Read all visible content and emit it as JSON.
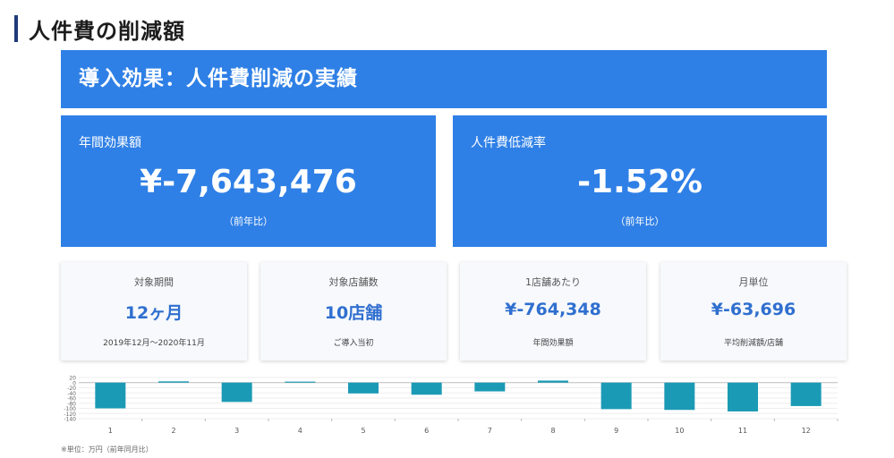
{
  "page_title": "人件費の削減額",
  "banner": {
    "title": "導入効果：人件費削減の実績"
  },
  "kpis": [
    {
      "label": "年間効果額",
      "value": "¥-7,643,476",
      "note": "（前年比）"
    },
    {
      "label": "人件費低減率",
      "value": "-1.52%",
      "note": "（前年比）"
    }
  ],
  "cards": [
    {
      "label": "対象期間",
      "value": "12ヶ月",
      "note": "2019年12月〜2020年11月"
    },
    {
      "label": "対象店舗数",
      "value": "10店舗",
      "note": "ご導入当初"
    },
    {
      "label": "1店舗あたり",
      "value": "¥-764,348",
      "note": "年間効果額"
    },
    {
      "label": "月単位",
      "value": "¥-63,696",
      "note": "平均削減額/店舗"
    }
  ],
  "footnote": "※単位：万円（前年同月比）",
  "colors": {
    "accent": "#2f80e6",
    "bar": "#1b9ab5",
    "card_value": "#2f6fcf"
  },
  "chart_data": {
    "type": "bar",
    "categories": [
      "1",
      "2",
      "3",
      "4",
      "5",
      "6",
      "7",
      "8",
      "9",
      "10",
      "11",
      "12"
    ],
    "values": [
      -100,
      5,
      -75,
      4,
      -42,
      -47,
      -34,
      8,
      -103,
      -106,
      -112,
      -91
    ],
    "ylim": [
      -140,
      20
    ],
    "yticks": [
      20,
      0,
      -20,
      -40,
      -60,
      -80,
      -100,
      -120,
      -140
    ],
    "ytick_labels": [
      "20",
      "0",
      "-20",
      "-40",
      "-60",
      "-80",
      "-100",
      "-120",
      "-140"
    ],
    "grid": true
  }
}
